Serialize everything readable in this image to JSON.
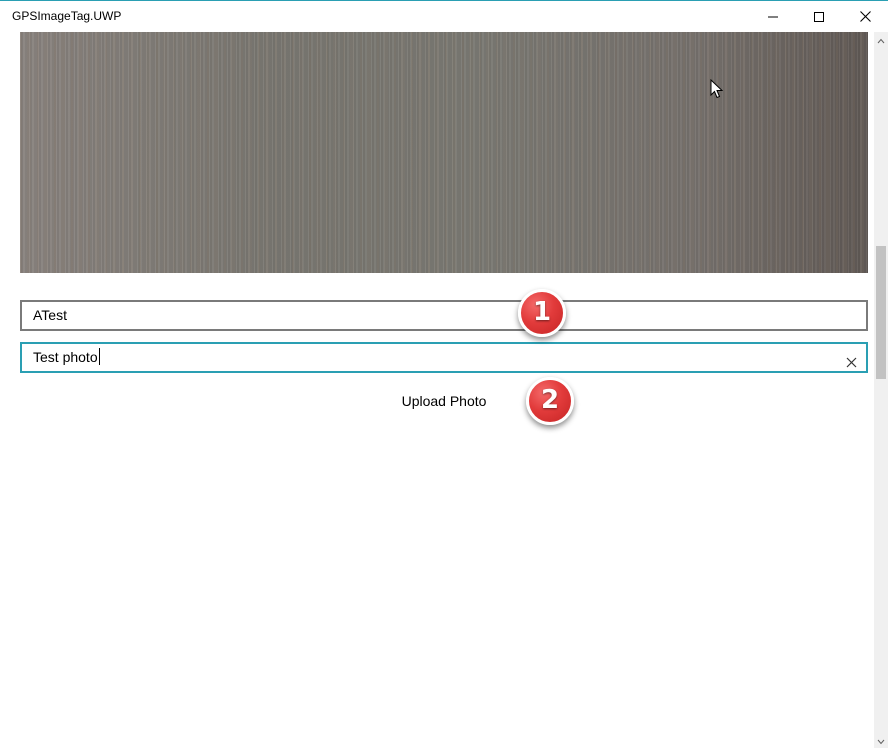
{
  "window": {
    "title": "GPSImageTag.UWP",
    "accent_color": "#2a9fb3"
  },
  "controls": {
    "minimize_icon": "minimize-icon",
    "maximize_icon": "maximize-icon",
    "close_icon": "close-icon"
  },
  "form": {
    "title_value": "ATest",
    "description_value": "Test photo",
    "clear_icon": "clear-x-icon",
    "upload_label": "Upload Photo"
  },
  "annotations": {
    "badge_1": "1",
    "badge_2": "2",
    "badge_color": "#e23b3b"
  }
}
